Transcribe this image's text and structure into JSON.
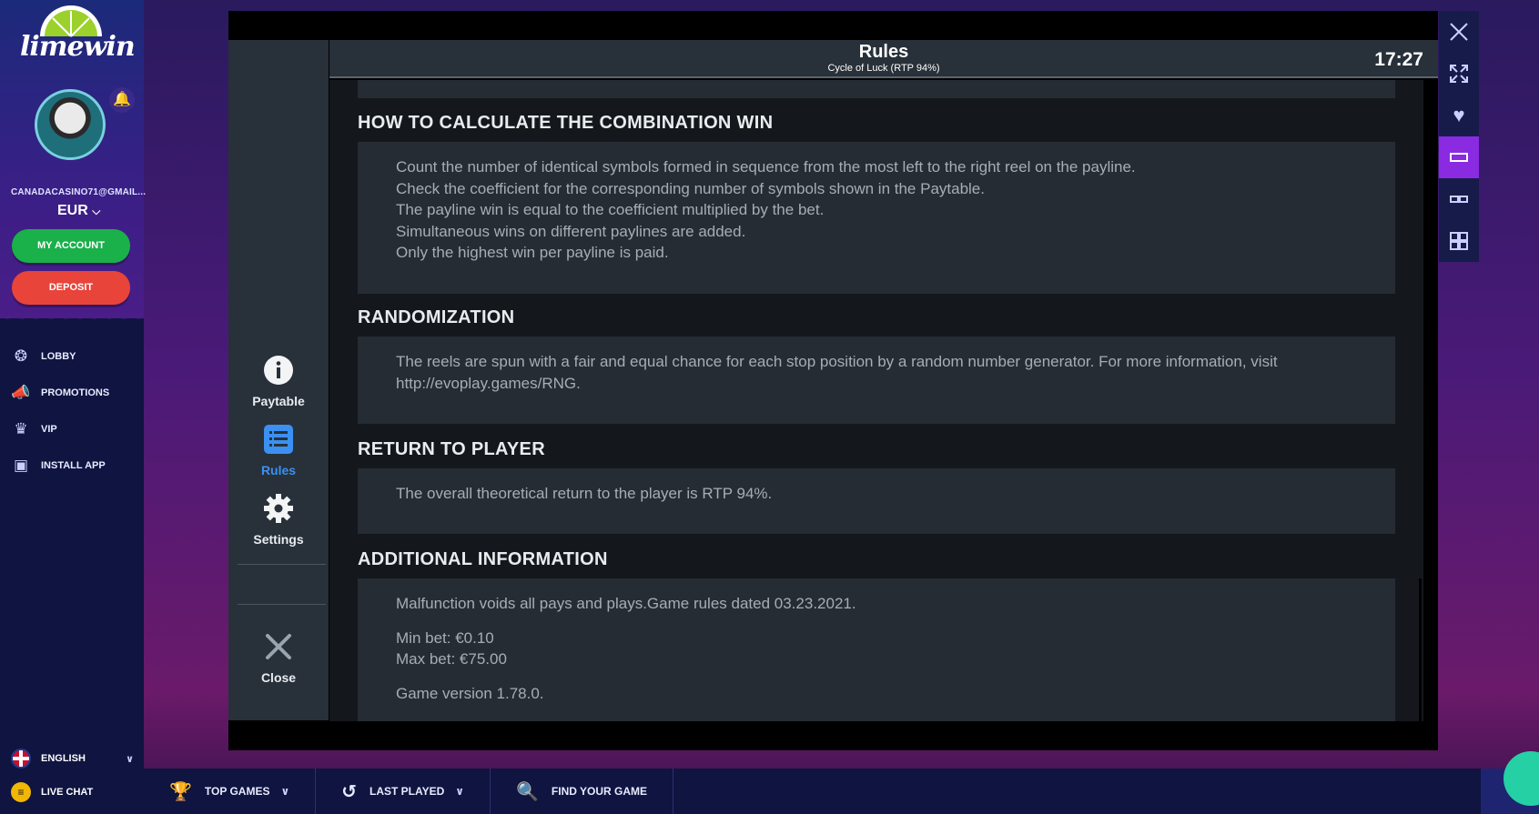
{
  "sidebar": {
    "logo_text": "limewin",
    "email": "CANADACASINO71@GMAIL...",
    "currency": "EUR",
    "my_account_label": "MY ACCOUNT",
    "deposit_label": "DEPOSIT",
    "nav": [
      {
        "label": "LOBBY",
        "icon": "lobby-icon"
      },
      {
        "label": "PROMOTIONS",
        "icon": "megaphone-icon"
      },
      {
        "label": "VIP",
        "icon": "crown-icon"
      },
      {
        "label": "INSTALL APP",
        "icon": "phone-icon"
      }
    ],
    "language": "ENGLISH",
    "live_chat": "LIVE CHAT"
  },
  "bottombar": {
    "top_games": "TOP GAMES",
    "last_played": "LAST PLAYED",
    "find_game": "FIND YOUR GAME"
  },
  "game": {
    "header": {
      "title": "Rules",
      "subtitle": "Cycle of Luck (RTP 94%)",
      "time": "17:27"
    },
    "nav": {
      "paytable": "Paytable",
      "rules": "Rules",
      "settings": "Settings",
      "close": "Close"
    },
    "sections": {
      "combination": {
        "title": "HOW TO CALCULATE THE COMBINATION WIN",
        "lines": [
          "Count the number of identical symbols formed in sequence from the most left to the right reel on the payline.",
          "Check the coefficient for the corresponding number of symbols shown in the Paytable.",
          "The payline win is equal to the coefficient multiplied by the bet.",
          "Simultaneous wins on different paylines are added.",
          "Only the highest win per payline is paid."
        ]
      },
      "randomization": {
        "title": "RANDOMIZATION",
        "text": "The reels are spun with a fair and equal chance for each stop position by a random number generator. For more information, visit http://evoplay.games/RNG."
      },
      "rtp": {
        "title": "RETURN TO PLAYER",
        "text": "The overall theoretical return to the player is RTP 94%."
      },
      "additional": {
        "title": "ADDITIONAL INFORMATION",
        "malfunction": "Malfunction voids all pays and plays.Game rules dated 03.23.2021.",
        "min_bet": "Min bet: €0.10",
        "max_bet": "Max bet: €75.00",
        "version": "Game version 1.78.0."
      }
    }
  },
  "colors": {
    "accent_active": "#3b90f2",
    "toolbar_active": "#8a2be2",
    "account_green": "#1ab04a",
    "deposit_red": "#e8443a"
  }
}
